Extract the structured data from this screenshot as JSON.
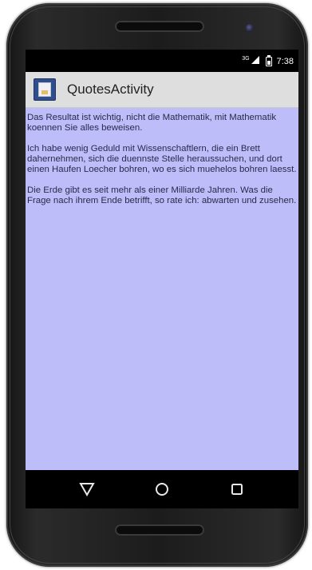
{
  "status_bar": {
    "network": "3G",
    "time": "7:38"
  },
  "app_bar": {
    "title": "QuotesActivity",
    "icon": "notebook-app-icon"
  },
  "quotes": [
    "Das Resultat ist wichtig, nicht die Mathematik, mit Mathematik koennen Sie alles beweisen.",
    "Ich habe wenig Geduld mit Wissenschaftlern, die ein Brett dahernehmen, sich die duennste Stelle heraussuchen, und dort einen Haufen Loecher bohren, wo es sich muehelos bohren laesst.",
    "Die Erde gibt es seit mehr als einer Milliarde Jahren. Was die Frage nach ihrem Ende betrifft, so rate ich: abwarten und zusehen."
  ],
  "nav_bar": {
    "back": "back-triangle-icon",
    "home": "home-circle-icon",
    "recents": "recents-square-icon"
  },
  "colors": {
    "content_background": "#bdbdfa",
    "app_bar_background": "#dedede",
    "status_bar_background": "#000000"
  }
}
